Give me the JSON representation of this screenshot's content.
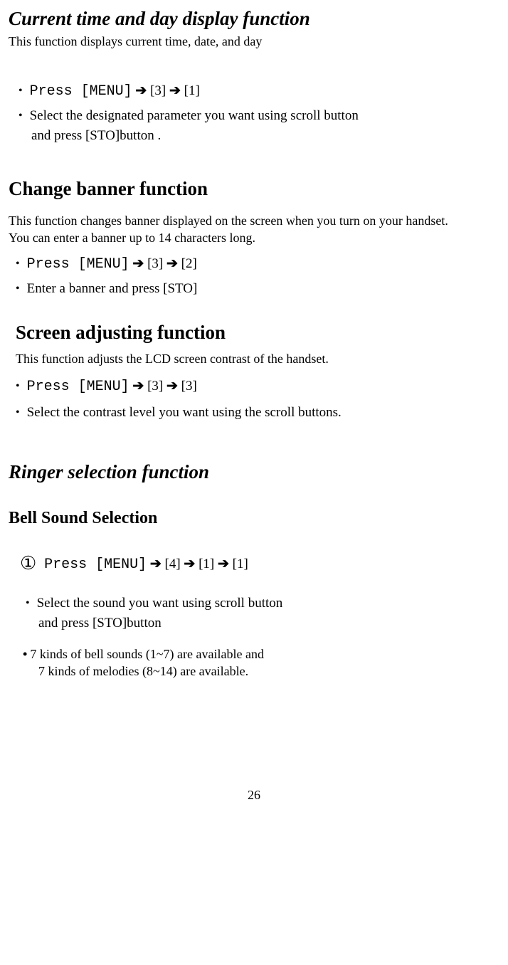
{
  "section1": {
    "title": "Current time and day display function",
    "desc": "This function displays current time, date, and day",
    "step1_prefix": "Press [MENU]",
    "step1_suffix": " [3] ",
    "step1_end": " [1]",
    "step2_line1": "Select the designated parameter you want using scroll button",
    "step2_line2": "and press [STO]button ."
  },
  "section2": {
    "title": "Change banner function",
    "desc_line1": "This function changes banner displayed on the screen when you turn on your handset.",
    "desc_line2": "You can enter a banner up to 14 characters long.",
    "step1_prefix": "Press [MENU]",
    "step1_mid": " [3] ",
    "step1_end": " [2]",
    "step2": "Enter a banner and press [STO]"
  },
  "section3": {
    "title": "Screen adjusting function",
    "desc": "This function adjusts the LCD screen contrast of the handset.",
    "step1_prefix": "Press [MENU]",
    "step1_mid": " [3] ",
    "step1_end": " [3]",
    "step2": "Select the contrast level you want using the scroll buttons."
  },
  "section4": {
    "title": "Ringer selection function",
    "subtitle": "Bell Sound Selection",
    "step1_prefix": "Press [MENU]",
    "step1_a": " [4] ",
    "step1_b": " [1] ",
    "step1_c": " [1]",
    "step2_line1": "Select the sound you want using scroll button",
    "step2_line2": "and press [STO]button",
    "note_line1": "7 kinds of bell sounds (1~7) are available and",
    "note_line2": "7 kinds of melodies (8~14) are available."
  },
  "arrow": "➔",
  "circled_one": "①",
  "page_number": "26"
}
